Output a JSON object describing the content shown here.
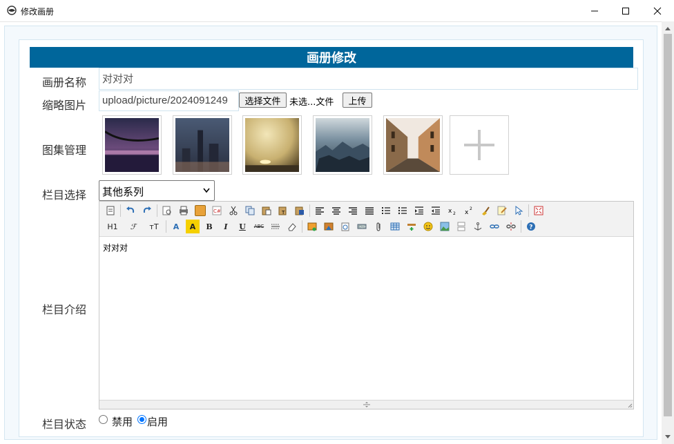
{
  "window": {
    "title": "修改画册"
  },
  "header": {
    "title": "画册修改"
  },
  "labels": {
    "name": "画册名称",
    "thumbnail": "缩略图片",
    "gallery": "图集管理",
    "category": "栏目选择",
    "intro": "栏目介绍",
    "status": "栏目状态"
  },
  "fields": {
    "name_value": "对对对",
    "thumbnail_path": "upload/picture/2024091249",
    "choose_file_label": "选择文件",
    "file_status": "未选...文件",
    "upload_label": "上传",
    "category_selected": "其他系列"
  },
  "gallery": {
    "images": [
      {
        "icon": "bridge-night-image"
      },
      {
        "icon": "city-skyline-image"
      },
      {
        "icon": "foggy-river-image"
      },
      {
        "icon": "old-town-rooftops-image"
      },
      {
        "icon": "narrow-street-image"
      }
    ],
    "add_icon": "plus-icon"
  },
  "editor": {
    "content": "对对对",
    "toolbar_row1": [
      "source",
      "undo",
      "redo",
      "preview",
      "print",
      "template",
      "code",
      "cut",
      "copy",
      "paste",
      "paste-text",
      "paste-word",
      "align-left",
      "align-center",
      "align-right",
      "justify",
      "ordered-list",
      "unordered-list",
      "indent",
      "outdent",
      "subscript",
      "superscript",
      "clear-format",
      "select-all",
      "select",
      "fullscreen"
    ],
    "toolbar_row2_text": {
      "heading": "H1",
      "font": "ℱ",
      "size": "тT",
      "font_color": "A",
      "highlight": "A",
      "bold": "B",
      "italic": "I",
      "underline": "U",
      "strike": "ABC"
    }
  },
  "status": {
    "disabled_label": "禁用",
    "enabled_label": "启用",
    "selected": "启用"
  },
  "colors": {
    "header_bg": "#00669b",
    "accent": "#0075ff"
  }
}
